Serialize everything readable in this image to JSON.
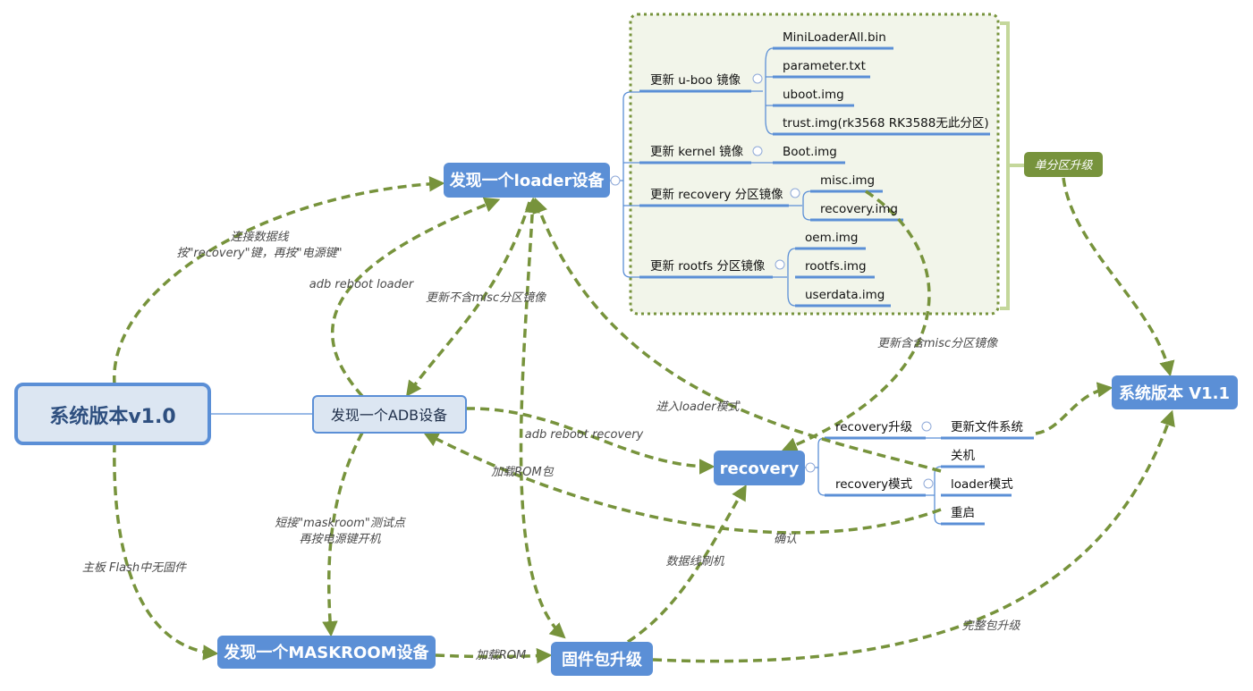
{
  "colors": {
    "node_fill": "#5b8fd6",
    "root_fill": "#dce6f2",
    "edge": "#77933c",
    "group_bg": "#f2f5ea",
    "bracket": "#c4d79b"
  },
  "nodes": {
    "root": "系统版本v1.0",
    "adb": "发现一个ADB设备",
    "loader": "发现一个loader设备",
    "maskroom": "发现一个MASKROOM设备",
    "firmware": "固件包升级",
    "recovery": "recovery",
    "v11": "系统版本 V1.1",
    "single": "单分区升级"
  },
  "loader_tree": {
    "uboot": {
      "label": "更新 u-boo 镜像",
      "children": [
        "MiniLoaderAll.bin",
        "parameter.txt",
        "uboot.img",
        "trust.img(rk3568 RK3588无此分区)"
      ]
    },
    "kernel": {
      "label": "更新 kernel 镜像",
      "children": [
        "Boot.img"
      ]
    },
    "recovery": {
      "label": "更新 recovery 分区镜像",
      "children": [
        "misc.img",
        "recovery.img"
      ]
    },
    "rootfs": {
      "label": "更新 rootfs 分区镜像",
      "children": [
        "oem.img",
        "rootfs.img",
        "userdata.img"
      ]
    }
  },
  "recovery_tree": {
    "upgrade": {
      "label": "recovery升级",
      "children": [
        "更新文件系统"
      ]
    },
    "mode": {
      "label": "recovery模式",
      "children": [
        "关机",
        "loader模式",
        "重启"
      ]
    }
  },
  "edge_labels": {
    "connect1": "连接数据线",
    "connect2": "按\"recovery\"键，再按\"电源键\"",
    "adb_reboot_loader": "adb reboot loader",
    "update_no_misc": "更新不含misc分区镜像",
    "enter_loader": "进入loader模式",
    "adb_reboot_recovery": "adb reboot recovery",
    "load_rom_pkg": "加载ROM包",
    "confirm": "确认",
    "short1": "短接\"maskroom\"测试点",
    "short2": "再按电源键开机",
    "no_firmware": "主板 Flash中无固件",
    "load_rom": "加载ROM",
    "usb_flash": "数据线刷机",
    "full_upgrade": "完整包升级",
    "update_misc": "更新含含misc分区镜像"
  }
}
